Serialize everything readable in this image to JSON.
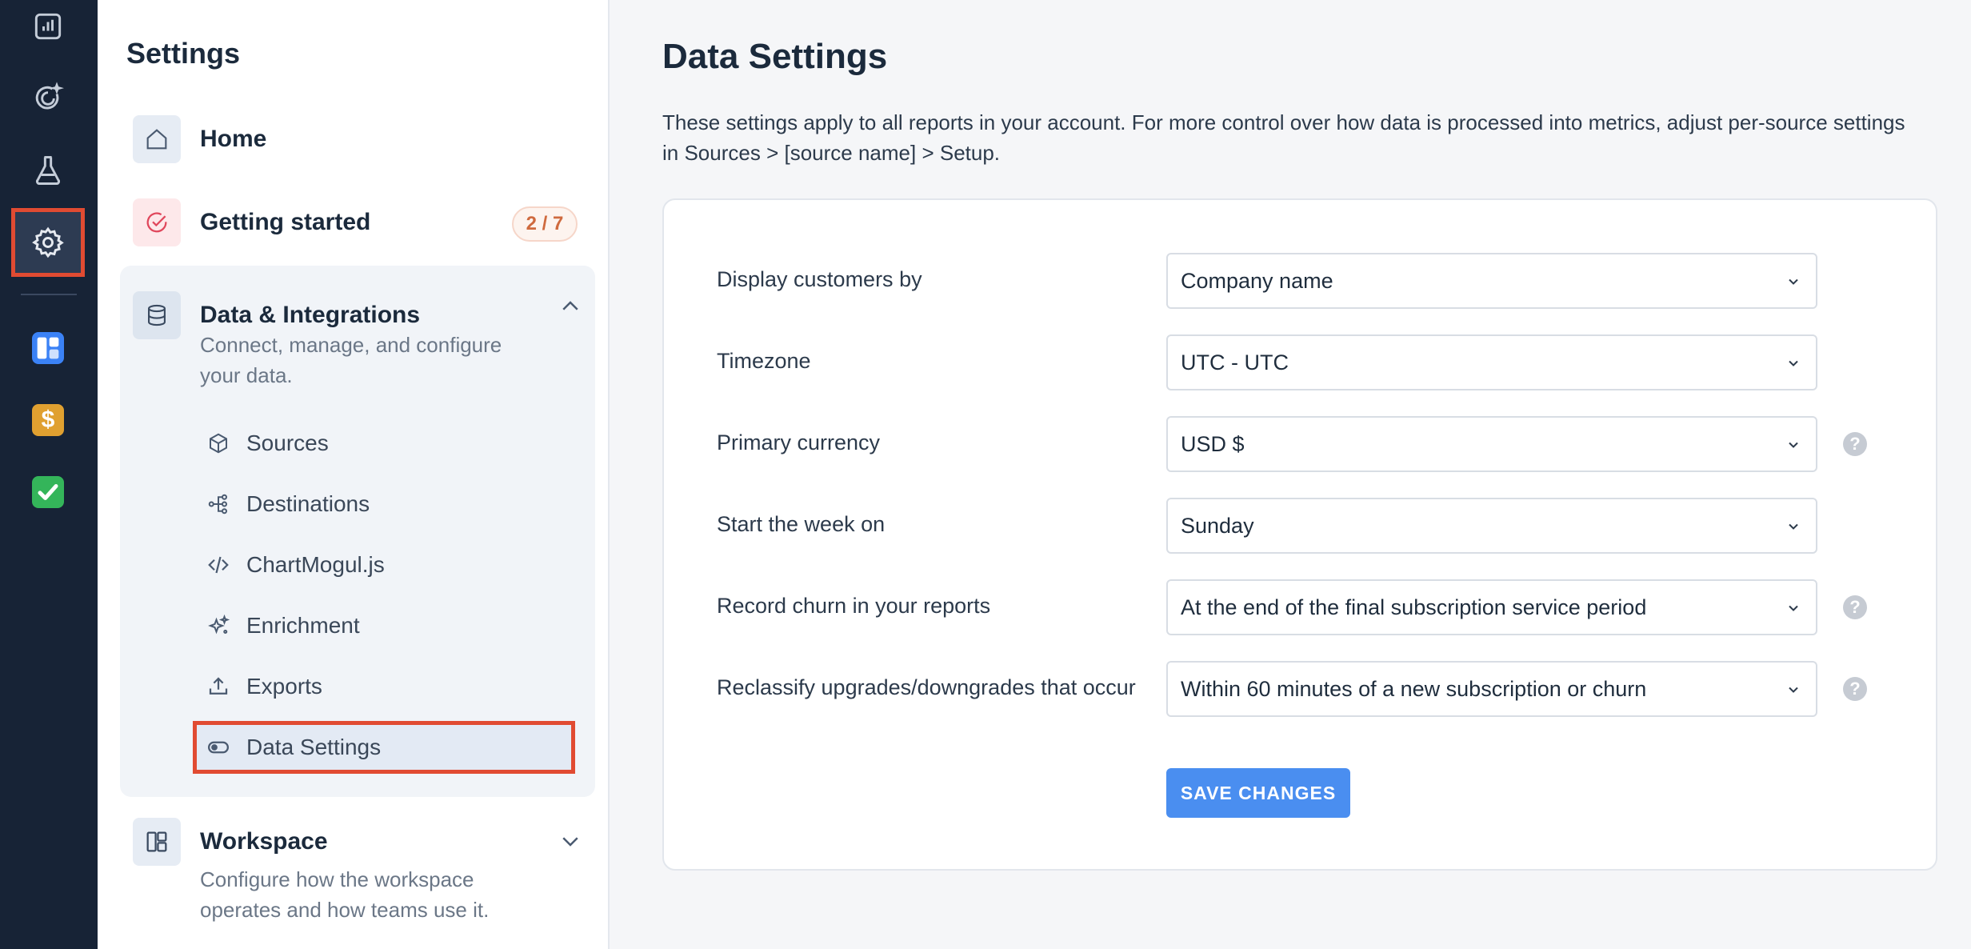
{
  "rail": {
    "items": [
      {
        "icon": "bar-chart-icon"
      },
      {
        "icon": "insights-icon"
      },
      {
        "icon": "flask-icon"
      },
      {
        "icon": "gear-icon",
        "active": true
      },
      {
        "icon": "board-app-icon",
        "color": "#3b82f6"
      },
      {
        "icon": "dollar-app-icon",
        "color": "#e0a030",
        "glyph": "$"
      },
      {
        "icon": "check-app-icon",
        "color": "#34b55a"
      }
    ]
  },
  "sidebar": {
    "title": "Settings",
    "home": {
      "label": "Home",
      "icon": "home-icon"
    },
    "getting_started": {
      "label": "Getting started",
      "badge": "2 / 7",
      "icon": "check-circle-icon"
    },
    "data_integrations": {
      "label": "Data & Integrations",
      "description": "Connect, manage, and configure your data.",
      "icon": "database-icon",
      "items": [
        {
          "label": "Sources",
          "icon": "cube-icon"
        },
        {
          "label": "Destinations",
          "icon": "share-nodes-icon"
        },
        {
          "label": "ChartMogul.js",
          "icon": "code-icon"
        },
        {
          "label": "Enrichment",
          "icon": "sparkle-icon"
        },
        {
          "label": "Exports",
          "icon": "upload-icon"
        },
        {
          "label": "Data Settings",
          "icon": "toggle-icon",
          "active": true
        }
      ]
    },
    "workspace": {
      "label": "Workspace",
      "description": "Configure how the workspace operates and how teams use it.",
      "icon": "layout-icon"
    }
  },
  "main": {
    "title": "Data Settings",
    "intro": "These settings apply to all reports in your account. For more control over how data is processed into metrics, adjust per-source settings in Sources > [source name] > Setup.",
    "settings": [
      {
        "label": "Display customers by",
        "value": "Company name",
        "help": false
      },
      {
        "label": "Timezone",
        "value": "UTC - UTC",
        "help": false
      },
      {
        "label": "Primary currency",
        "value": "USD $",
        "help": true
      },
      {
        "label": "Start the week on",
        "value": "Sunday",
        "help": false
      },
      {
        "label": "Record churn in your reports",
        "value": "At the end of the final subscription service period",
        "help": true
      },
      {
        "label": "Reclassify upgrades/downgrades that occur",
        "value": "Within 60 minutes of a new subscription or churn",
        "help": true
      }
    ],
    "help_glyph": "?",
    "save_label": "SAVE CHANGES"
  },
  "colors": {
    "rail_bg": "#172336",
    "accent_red": "#e14b32",
    "primary_blue": "#4a8ef0"
  }
}
